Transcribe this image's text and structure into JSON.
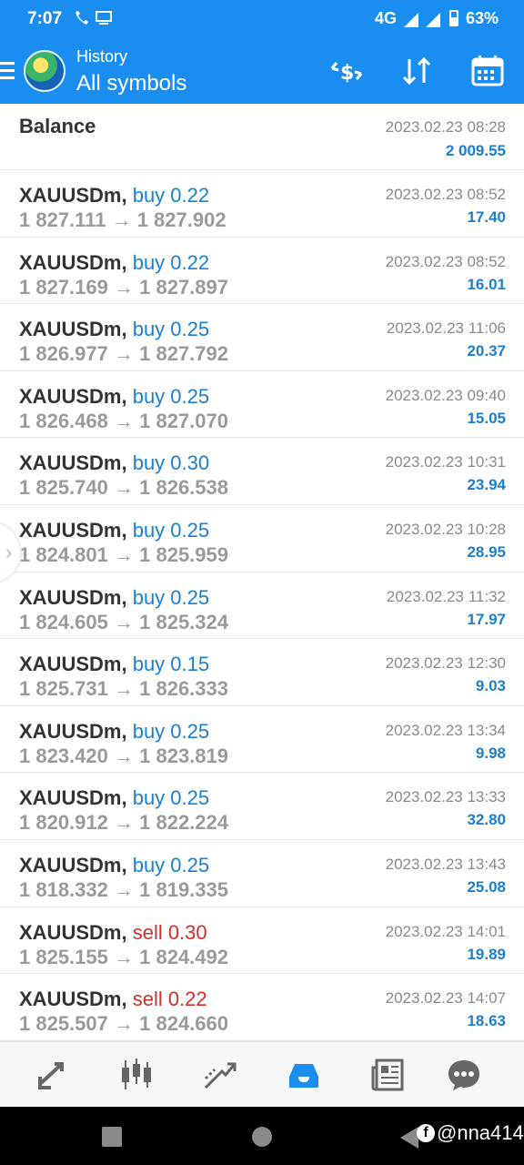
{
  "status": {
    "time": "7:07",
    "network": "4G",
    "battery": "63%"
  },
  "appbar": {
    "subtitle": "History",
    "title": "All symbols"
  },
  "balance": {
    "label": "Balance",
    "date": "2023.02.23 08:28",
    "value": "2 009.55"
  },
  "trades": [
    {
      "symbol": "XAUUSDm,",
      "side": "buy 0.22",
      "type": "buy",
      "open": "1 827.111",
      "close": "1 827.902",
      "date": "2023.02.23 08:52",
      "profit": "17.40"
    },
    {
      "symbol": "XAUUSDm,",
      "side": "buy 0.22",
      "type": "buy",
      "open": "1 827.169",
      "close": "1 827.897",
      "date": "2023.02.23 08:52",
      "profit": "16.01"
    },
    {
      "symbol": "XAUUSDm,",
      "side": "buy 0.25",
      "type": "buy",
      "open": "1 826.977",
      "close": "1 827.792",
      "date": "2023.02.23 11:06",
      "profit": "20.37"
    },
    {
      "symbol": "XAUUSDm,",
      "side": "buy 0.25",
      "type": "buy",
      "open": "1 826.468",
      "close": "1 827.070",
      "date": "2023.02.23 09:40",
      "profit": "15.05"
    },
    {
      "symbol": "XAUUSDm,",
      "side": "buy 0.30",
      "type": "buy",
      "open": "1 825.740",
      "close": "1 826.538",
      "date": "2023.02.23 10:31",
      "profit": "23.94"
    },
    {
      "symbol": "XAUUSDm,",
      "side": "buy 0.25",
      "type": "buy",
      "open": "1 824.801",
      "close": "1 825.959",
      "date": "2023.02.23 10:28",
      "profit": "28.95"
    },
    {
      "symbol": "XAUUSDm,",
      "side": "buy 0.25",
      "type": "buy",
      "open": "1 824.605",
      "close": "1 825.324",
      "date": "2023.02.23 11:32",
      "profit": "17.97"
    },
    {
      "symbol": "XAUUSDm,",
      "side": "buy 0.15",
      "type": "buy",
      "open": "1 825.731",
      "close": "1 826.333",
      "date": "2023.02.23 12:30",
      "profit": "9.03"
    },
    {
      "symbol": "XAUUSDm,",
      "side": "buy 0.25",
      "type": "buy",
      "open": "1 823.420",
      "close": "1 823.819",
      "date": "2023.02.23 13:34",
      "profit": "9.98"
    },
    {
      "symbol": "XAUUSDm,",
      "side": "buy 0.25",
      "type": "buy",
      "open": "1 820.912",
      "close": "1 822.224",
      "date": "2023.02.23 13:33",
      "profit": "32.80"
    },
    {
      "symbol": "XAUUSDm,",
      "side": "buy 0.25",
      "type": "buy",
      "open": "1 818.332",
      "close": "1 819.335",
      "date": "2023.02.23 13:43",
      "profit": "25.08"
    },
    {
      "symbol": "XAUUSDm,",
      "side": "sell 0.30",
      "type": "sell",
      "open": "1 825.155",
      "close": "1 824.492",
      "date": "2023.02.23 14:01",
      "profit": "19.89"
    },
    {
      "symbol": "XAUUSDm,",
      "side": "sell 0.22",
      "type": "sell",
      "open": "1 825.507",
      "close": "1 824.660",
      "date": "2023.02.23 14:07",
      "profit": "18.63"
    }
  ],
  "arrow": "→",
  "watermark": "@nna414",
  "colors": {
    "accent": "#1a8df0",
    "buy": "#1a7fd1",
    "sell": "#d0302b",
    "active_nav": "#1a8df0"
  },
  "nav": [
    "quotes-icon",
    "chart-icon",
    "trade-icon",
    "history-icon",
    "news-icon",
    "chat-icon"
  ]
}
